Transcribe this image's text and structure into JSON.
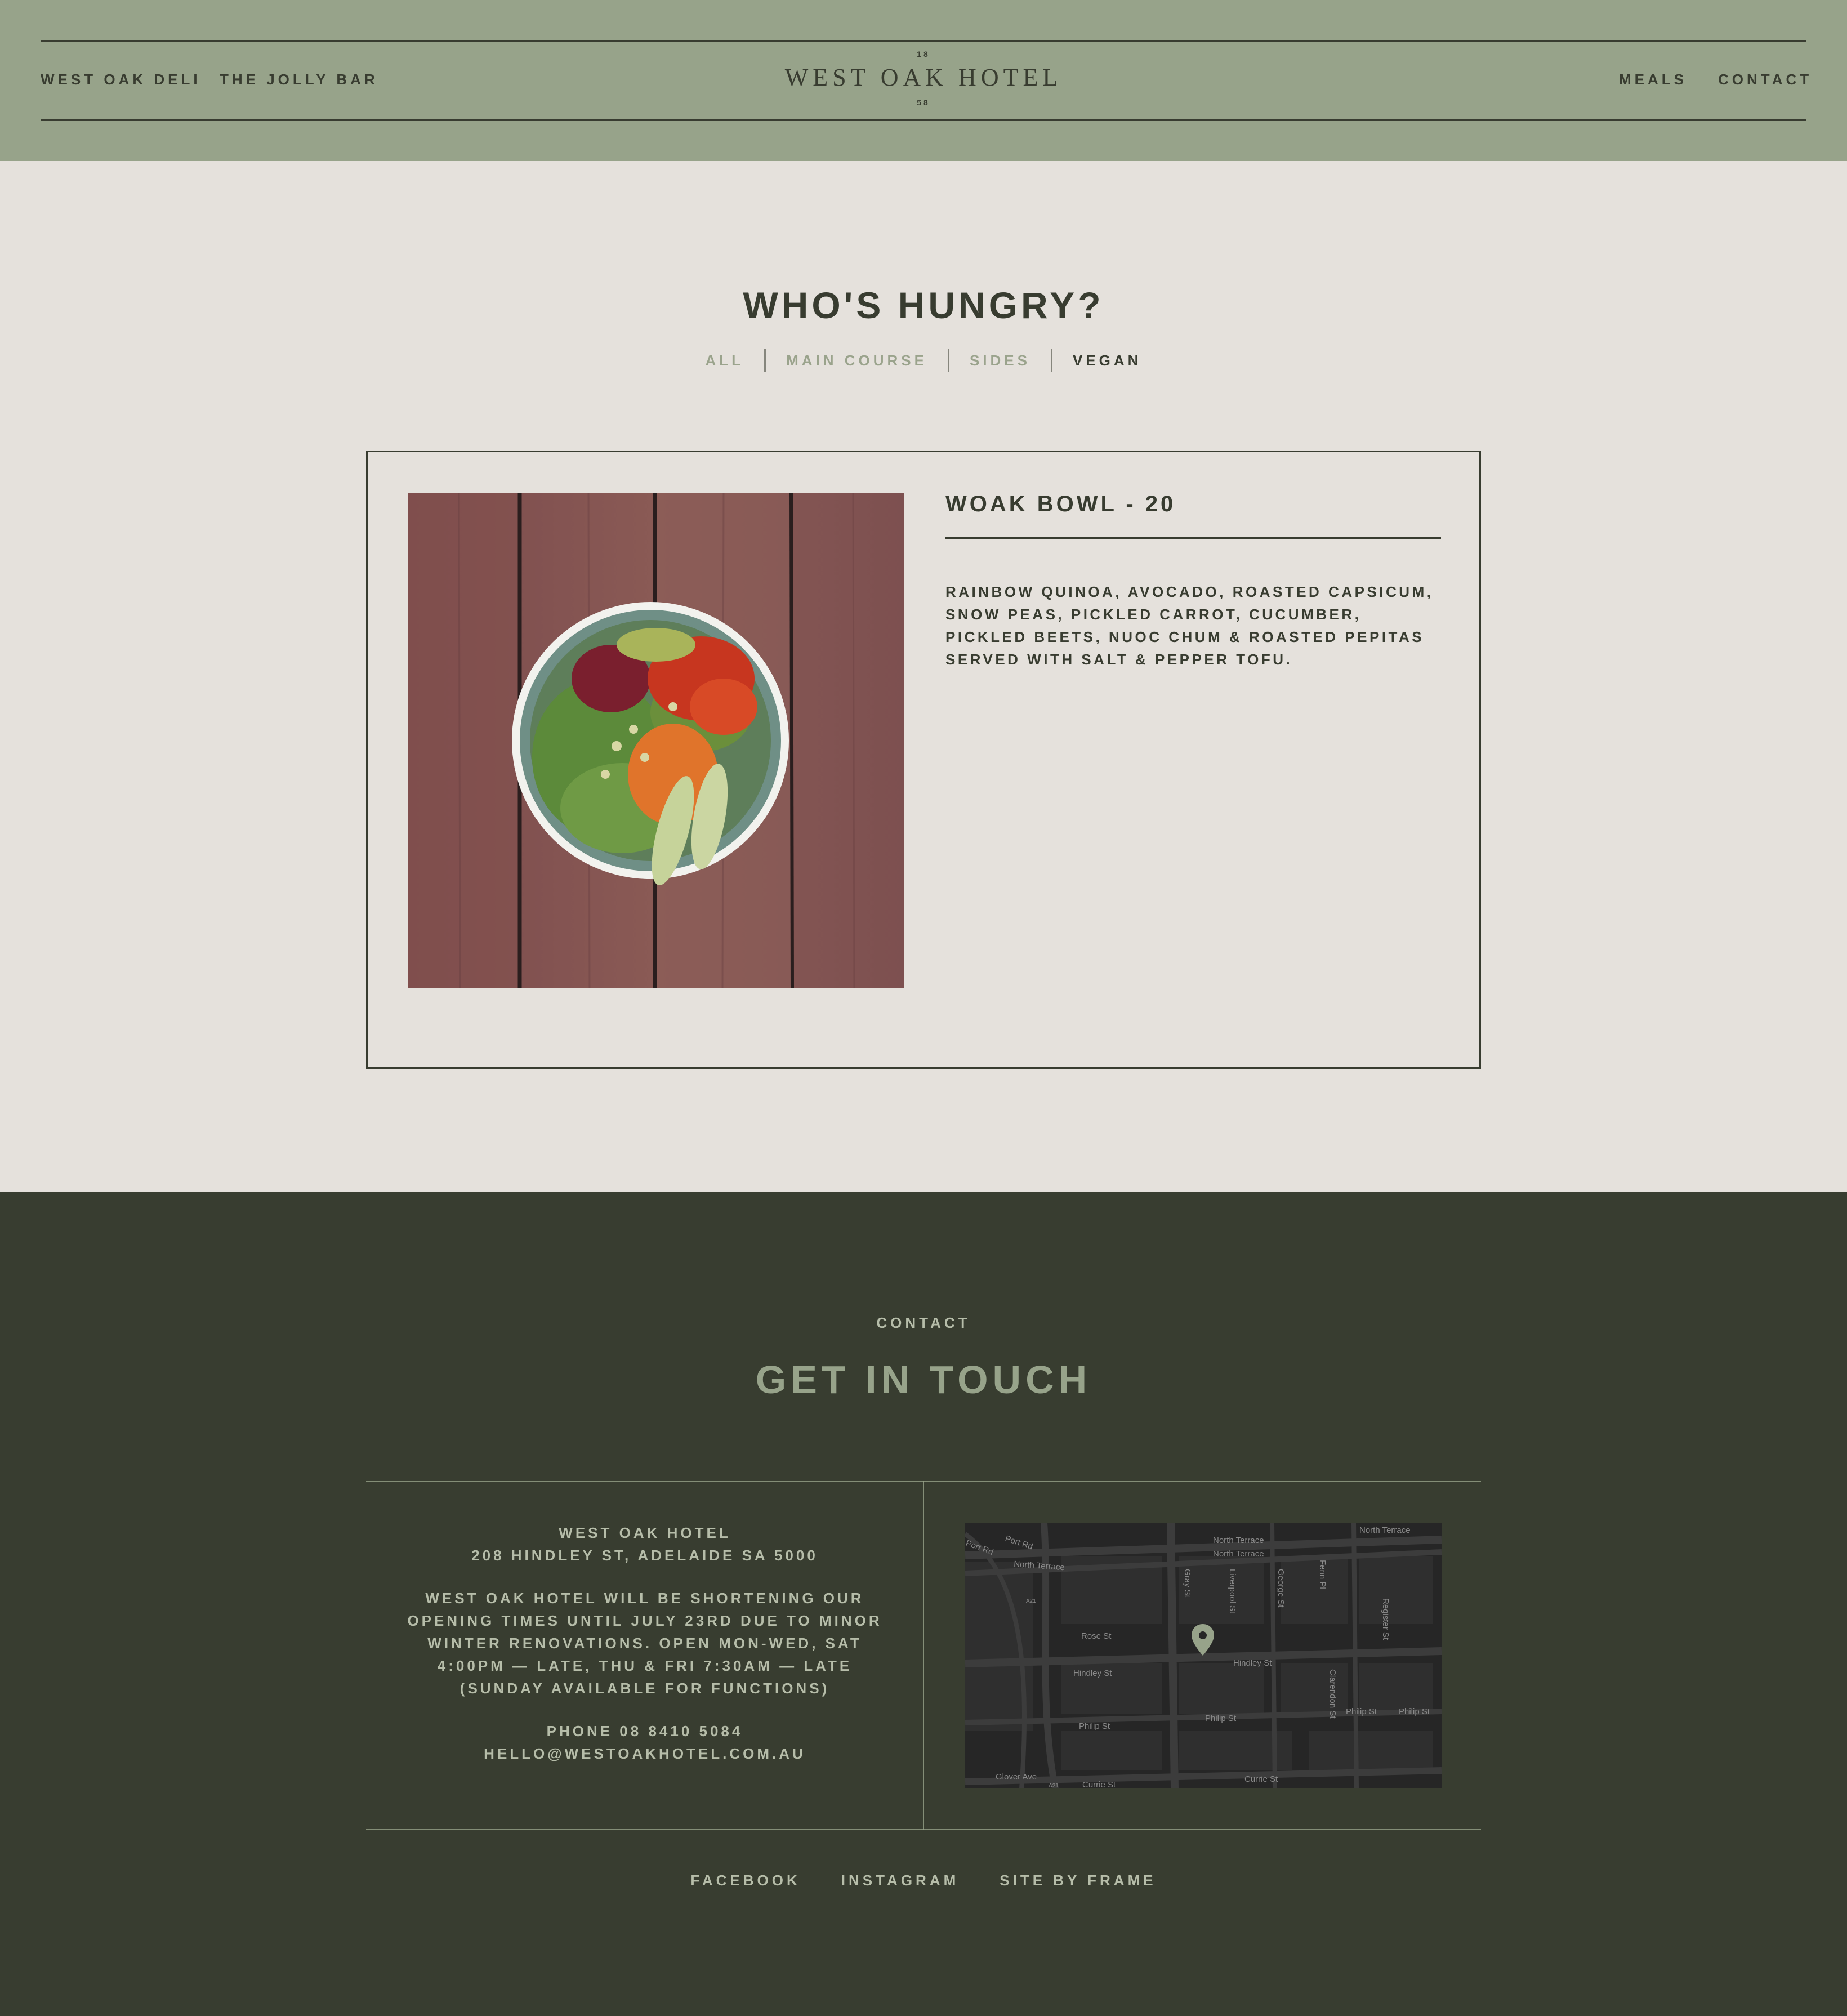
{
  "header": {
    "nav_left": [
      "WEST OAK DELI",
      "THE JOLLY BAR"
    ],
    "nav_right": [
      "MEALS",
      "CONTACT"
    ],
    "logo": {
      "year_top": "18",
      "name": "WEST OAK HOTEL",
      "year_bottom": "58"
    }
  },
  "menu": {
    "title": "WHO'S HUNGRY?",
    "filters": [
      "ALL",
      "MAIN COURSE",
      "SIDES",
      "VEGAN"
    ],
    "active_filter": "VEGAN",
    "items": [
      {
        "title": "WOAK BOWL - 20",
        "description": "RAINBOW QUINOA, AVOCADO, ROASTED CAPSICUM, SNOW PEAS, PICKLED CARROT, CUCUMBER, PICKLED BEETS, NUOC CHUM & ROASTED PEPITAS SERVED WITH SALT & PEPPER TOFU."
      }
    ]
  },
  "contact": {
    "eyebrow": "CONTACT",
    "title": "GET IN TOUCH",
    "hotel_name": "WEST OAK HOTEL",
    "address": "208 HINDLEY ST, ADELAIDE SA 5000",
    "notice": "WEST OAK HOTEL WILL BE SHORTENING OUR OPENING TIMES UNTIL JULY 23RD DUE TO MINOR WINTER RENOVATIONS. OPEN MON-WED, SAT 4:00PM — LATE, THU & FRI 7:30AM — LATE (SUNDAY AVAILABLE FOR FUNCTIONS)",
    "phone": "PHONE 08 8410 5084",
    "email": "HELLO@WESTOAKHOTEL.COM.AU",
    "map_labels": {
      "port_rd": "Port Rd",
      "port_rd_2": "Port Rd",
      "north_terrace_1": "North Terrace",
      "north_terrace_2": "North Terrace",
      "north_terrace_3": "North Terrace",
      "north_terrace_4": "North Terrace",
      "a21": "A21",
      "gray_st": "Gray St",
      "liverpool_st": "Liverpool St",
      "george_st": "George St",
      "fenn_pl": "Fenn Pl",
      "register_st": "Register St",
      "rose_st": "Rose St",
      "hindley_st_1": "Hindley St",
      "hindley_st_2": "Hindley St",
      "clarendon_st": "Clarendon St",
      "philip_st_1": "Philip St",
      "philip_st_2": "Philip St",
      "philip_st_3": "Philip St",
      "philip_st_4": "Philip St",
      "glover_ave": "Glover Ave",
      "a21_b": "A21",
      "currie_st_1": "Currie St",
      "currie_st_2": "Currie St"
    }
  },
  "footer_links": [
    "FACEBOOK",
    "INSTAGRAM",
    "SITE BY FRAME"
  ],
  "colors": {
    "header_bg": "#97a38a",
    "page_bg": "#e5e1dc",
    "footer_bg": "#383d30",
    "text_dark": "#383c30",
    "accent_sage": "#97a38a",
    "map_bg": "#262626"
  },
  "icons": {
    "map_pin": "location-pin-icon"
  }
}
